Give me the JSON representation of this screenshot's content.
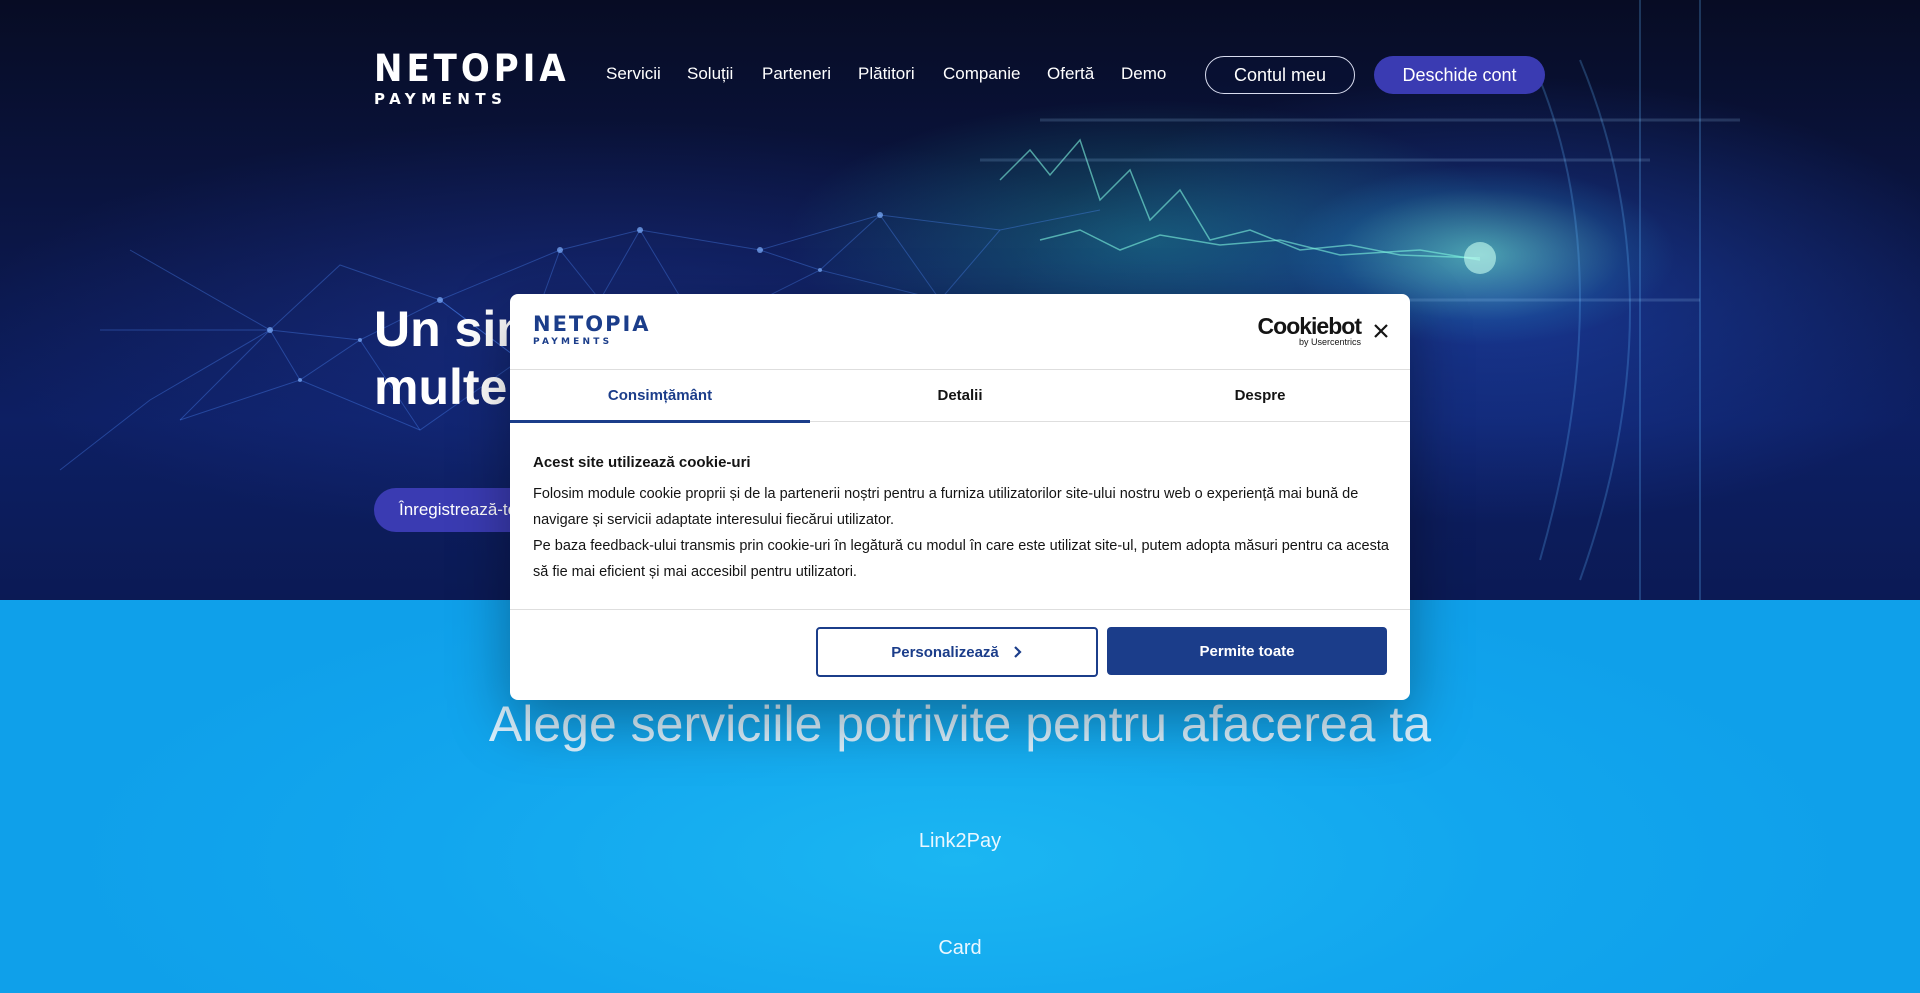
{
  "brand": {
    "line1": "NETOPIA",
    "line2": "PAYMENTS"
  },
  "nav": {
    "items": [
      {
        "id": "servicii",
        "label": "Servicii"
      },
      {
        "id": "solutii",
        "label": "Soluții"
      },
      {
        "id": "parteneri",
        "label": "Parteneri"
      },
      {
        "id": "platitori",
        "label": "Plătitori"
      },
      {
        "id": "companie",
        "label": "Companie"
      },
      {
        "id": "oferta",
        "label": "Ofertă"
      },
      {
        "id": "demo",
        "label": "Demo"
      }
    ],
    "account_label": "Contul meu",
    "open_account_label": "Deschide cont"
  },
  "hero": {
    "title_line1": "Un sin",
    "title_line2": "multe",
    "register_label": "Înregistrează-te"
  },
  "services": {
    "heading": "Alege serviciile potrivite pentru afacerea ta",
    "items": [
      "Link2Pay",
      "Card"
    ]
  },
  "cookie_dialog": {
    "provider_main": "Cookiebot",
    "provider_sub": "by Usercentrics",
    "tabs": [
      {
        "label": "Consimțământ",
        "active": true
      },
      {
        "label": "Detalii",
        "active": false
      },
      {
        "label": "Despre",
        "active": false
      }
    ],
    "heading": "Acest site utilizează cookie-uri",
    "paragraph1": "Folosim module cookie proprii și de la partenerii noștri pentru a furniza utilizatorilor site-ului nostru web o experiență mai bună de navigare și servicii adaptate interesului fiecărui utilizator.",
    "paragraph2": "Pe baza feedback-ului transmis prin cookie-uri în legătură cu modul în care este utilizat site-ul, putem adopta măsuri pentru ca acesta să fie mai eficient și mai accesibil pentru utilizatori.",
    "customize_label": "Personalizează",
    "allow_all_label": "Permite toate"
  },
  "colors": {
    "brand_blue": "#1b3d8a",
    "cta_purple": "#3a3bb2",
    "sky_blue": "#12a6ee"
  }
}
